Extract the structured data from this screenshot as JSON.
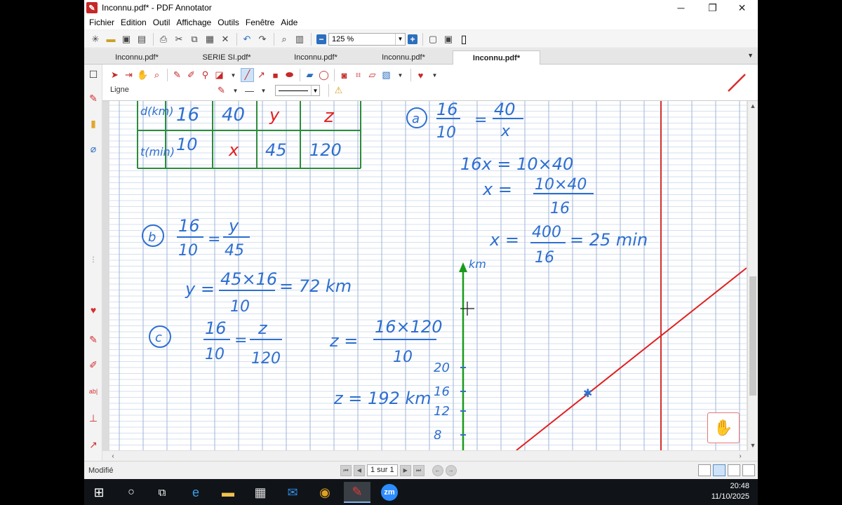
{
  "window": {
    "title": "Inconnu.pdf* - PDF Annotator",
    "icon": "pdf-annotator-logo-icon",
    "controls": [
      "minimize",
      "restore",
      "close"
    ]
  },
  "menu": [
    "Fichier",
    "Edition",
    "Outil",
    "Affichage",
    "Outils",
    "Fenêtre",
    "Aide"
  ],
  "toolbar": {
    "zoom_value": "125 %"
  },
  "tabs": [
    {
      "label": "Inconnu.pdf*",
      "active": false
    },
    {
      "label": "SERIE SI.pdf*",
      "active": false
    },
    {
      "label": "Inconnu.pdf*",
      "active": false
    },
    {
      "label": "Inconnu.pdf*",
      "active": false
    },
    {
      "label": "Inconnu.pdf*",
      "active": true
    }
  ],
  "annotation_toolbar": {
    "current_tool": "Ligne",
    "tool_color": "#d32f2f"
  },
  "document": {
    "pen_color": "#2e6fd0",
    "grid_color": "#2d8c3c",
    "axis_color": "#1a9a1a",
    "line_color": "#e02020",
    "margin_color": "#d32f2f",
    "table": {
      "row1": [
        "d(km)",
        "16",
        "40",
        "y",
        "z"
      ],
      "row2": [
        "t(min)",
        "10",
        "x",
        "45",
        "120"
      ]
    },
    "part_a": {
      "label": "a",
      "eq1_num_left": "16",
      "eq1_den_left": "10",
      "eq1_num_right": "40",
      "eq1_den_right": "x",
      "step1": "16x = 10×40",
      "step2_left": "x =",
      "step2_num": "10×40",
      "step2_den": "16",
      "step3_left": "x =",
      "step3_num": "400",
      "step3_den": "16",
      "step3_result": "= 25 min"
    },
    "part_b": {
      "label": "b",
      "num_left": "16",
      "den_left": "10",
      "num_right": "y",
      "den_right": "45",
      "solve_left": "y =",
      "solve_num": "45×16",
      "solve_den": "10",
      "solve_result": "= 72 km"
    },
    "part_c": {
      "label": "c",
      "num_left": "16",
      "den_left": "10",
      "num_right": "z",
      "den_right": "120",
      "solve_left": "z =",
      "solve_num": "16×120",
      "solve_den": "10",
      "final": "z = 192 km"
    },
    "graph": {
      "axis_label": "km",
      "ticks": [
        "20",
        "16",
        "12",
        "8"
      ]
    }
  },
  "status": {
    "text": "Modifié",
    "page_indicator": "1 sur 1"
  },
  "taskbar": {
    "time": "20:48",
    "date": "11/10/2025",
    "apps": [
      "start-icon",
      "search-icon",
      "task-view-icon",
      "edge-icon",
      "file-explorer-icon",
      "store-icon",
      "mail-icon",
      "chrome-icon",
      "pdf-annotator-icon",
      "zoom-icon"
    ]
  }
}
